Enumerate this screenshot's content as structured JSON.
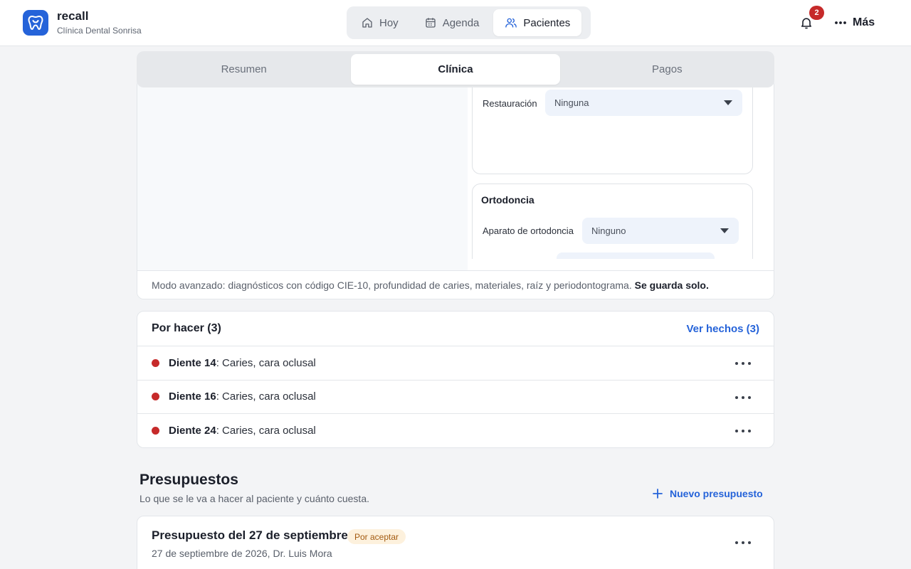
{
  "app": {
    "name": "recall",
    "clinic": "Clínica Dental Sonrisa"
  },
  "nav": {
    "items": [
      {
        "label": "Hoy",
        "icon": "home-icon"
      },
      {
        "label": "Agenda",
        "icon": "calendar-icon"
      },
      {
        "label": "Pacientes",
        "icon": "users-icon",
        "active": true
      }
    ]
  },
  "header": {
    "notifications_count": "2",
    "more_label": "Más"
  },
  "tabs": [
    "Resumen",
    "Clínica",
    "Pagos"
  ],
  "clinical": {
    "restoration_label": "Restauración",
    "restoration_value": "Ninguna",
    "ortho_title": "Ortodoncia",
    "ortho_label": "Aparato de ortodoncia",
    "ortho_value": "Ninguno",
    "advanced_note": "Modo avanzado: diagnósticos con código CIE-10, profundidad de caries, materiales, raíz y periodontograma.",
    "advanced_note_strong": "Se guarda solo."
  },
  "todo": {
    "title": "Por hacer (3)",
    "done_link": "Ver hechos (3)",
    "items": [
      {
        "tooth": "Diente 14",
        "description": "Caries, cara oclusal"
      },
      {
        "tooth": "Diente 16",
        "description": "Caries, cara oclusal"
      },
      {
        "tooth": "Diente 24",
        "description": "Caries, cara oclusal"
      }
    ]
  },
  "budgets": {
    "title": "Presupuestos",
    "subtitle": "Lo que se le va a hacer al paciente y cuánto cuesta.",
    "new_button": "Nuevo presupuesto",
    "items": [
      {
        "name": "Presupuesto del 27 de septiembre",
        "status": "Por aceptar",
        "meta": "27 de septiembre de 2026, Dr. Luis Mora"
      }
    ]
  },
  "colors": {
    "accent": "#2563d9",
    "danger": "#c62a2a",
    "pending_bg": "#fdf1dd",
    "pending_text": "#a35a10"
  }
}
